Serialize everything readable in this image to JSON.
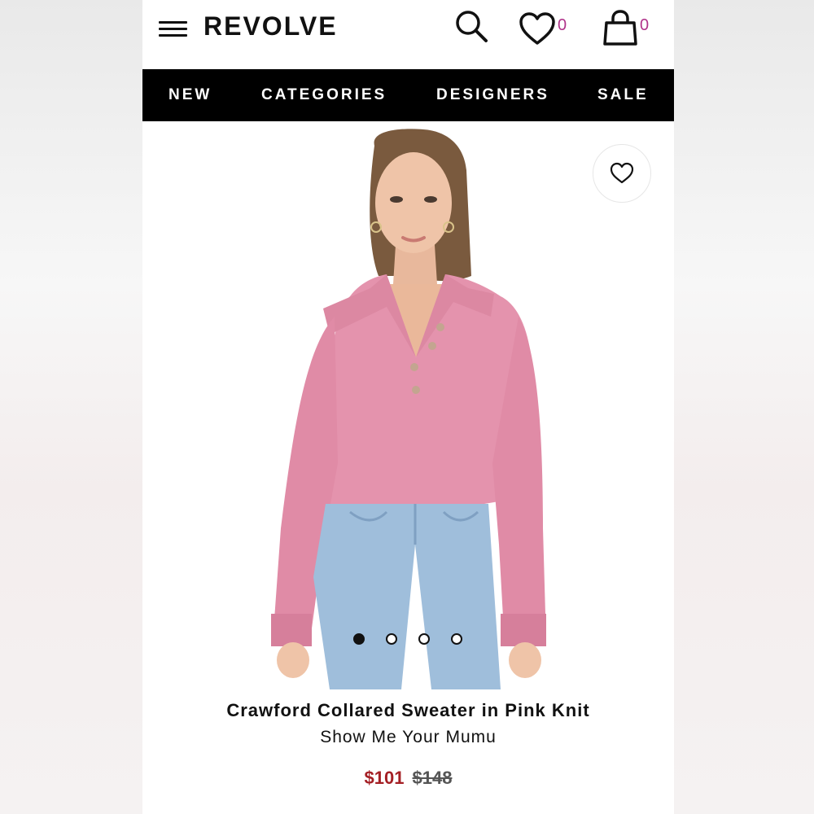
{
  "header": {
    "logo": "REVOLVE",
    "wishlist_count": "0",
    "bag_count": "0",
    "icons": [
      "menu-icon",
      "search-icon",
      "heart-icon",
      "shopping-bag-icon"
    ],
    "accent_color": "#b0338a"
  },
  "nav": {
    "items": [
      {
        "label": "NEW"
      },
      {
        "label": "CATEGORIES"
      },
      {
        "label": "DESIGNERS"
      },
      {
        "label": "SALE"
      }
    ]
  },
  "product": {
    "image_description_icon": "product-photo",
    "favorite_icon": "heart-outline-icon",
    "carousel_total": 4,
    "carousel_active": 1,
    "title": "Crawford Collared Sweater in Pink Knit",
    "brand": "Show Me Your Mumu",
    "price_sale": "$101",
    "price_original": "$148",
    "sale_color": "#a41f24"
  }
}
